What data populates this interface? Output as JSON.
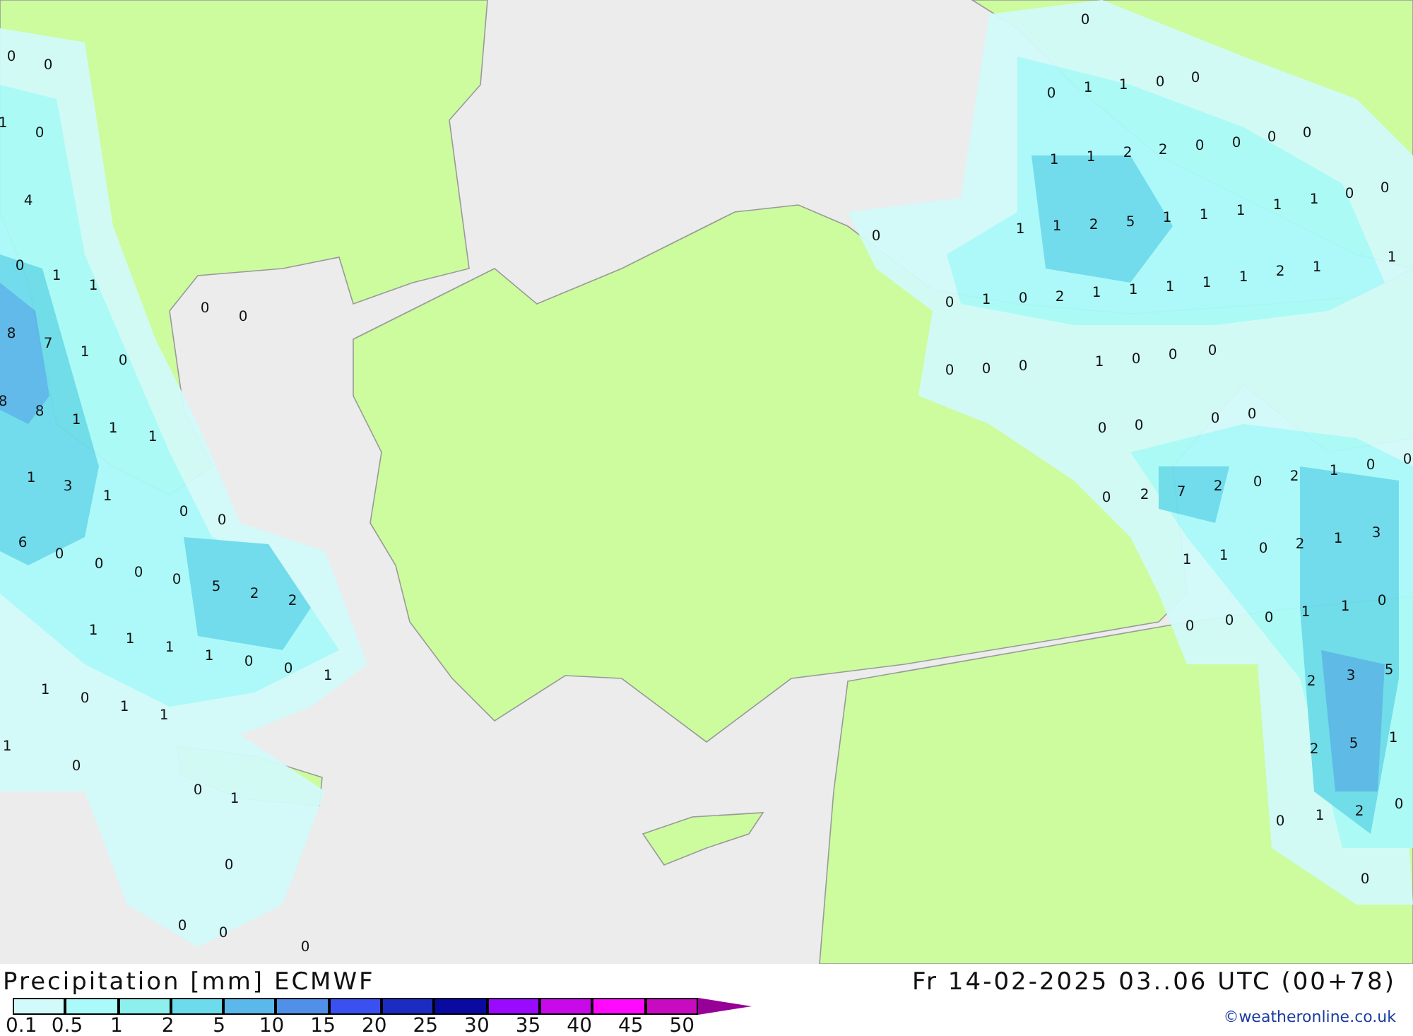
{
  "map": {
    "values": [
      "0",
      "0",
      "1",
      "0",
      "4",
      "0",
      "1",
      "1",
      "8",
      "7",
      "1",
      "0",
      "8",
      "8",
      "1",
      "1",
      "1",
      "1",
      "3",
      "1",
      "0",
      "0",
      "6",
      "0",
      "0",
      "0",
      "0",
      "5",
      "2",
      "2",
      "1",
      "1",
      "1",
      "1",
      "0",
      "0",
      "1",
      "1",
      "0",
      "1",
      "1",
      "1",
      "0",
      "0",
      "1",
      "0",
      "0",
      "0",
      "0",
      "0",
      "0",
      "0",
      "0",
      "1",
      "1",
      "0",
      "0",
      "1",
      "1",
      "2",
      "2",
      "0",
      "0",
      "0",
      "0",
      "1",
      "1",
      "2",
      "5",
      "1",
      "1",
      "1",
      "1",
      "1",
      "0",
      "0",
      "0",
      "0",
      "1",
      "0",
      "2",
      "1",
      "1",
      "1",
      "1",
      "1",
      "2",
      "1",
      "1",
      "0",
      "0",
      "0",
      "1",
      "0",
      "0",
      "0",
      "0",
      "0",
      "0",
      "0",
      "0",
      "2",
      "7",
      "2",
      "0",
      "2",
      "1",
      "0",
      "0",
      "1",
      "1",
      "0",
      "2",
      "1",
      "3",
      "0",
      "0",
      "0",
      "1",
      "1",
      "0",
      "2",
      "3",
      "5",
      "2",
      "5",
      "1",
      "0",
      "1",
      "2",
      "0",
      "0"
    ]
  },
  "legend": {
    "title": "Precipitation [mm] ECMWF",
    "bins": [
      {
        "color": "#d2fafa"
      },
      {
        "color": "#aafafa"
      },
      {
        "color": "#8ef0ec"
      },
      {
        "color": "#6cdcec"
      },
      {
        "color": "#5ab8ea"
      },
      {
        "color": "#5090e8"
      },
      {
        "color": "#3a50f0"
      },
      {
        "color": "#1c2cc0"
      },
      {
        "color": "#0a0aa0"
      },
      {
        "color": "#9a0aff"
      },
      {
        "color": "#c80ae8"
      },
      {
        "color": "#ff0aff"
      },
      {
        "color": "#c80ac0"
      }
    ],
    "ticks": [
      "0.1",
      "0.5",
      "1",
      "2",
      "5",
      "10",
      "15",
      "20",
      "25",
      "30",
      "35",
      "40",
      "45",
      "50"
    ]
  },
  "valid_time": "Fr 14-02-2025 03..06 UTC (00+78)",
  "credit": "©weatheronline.co.uk"
}
